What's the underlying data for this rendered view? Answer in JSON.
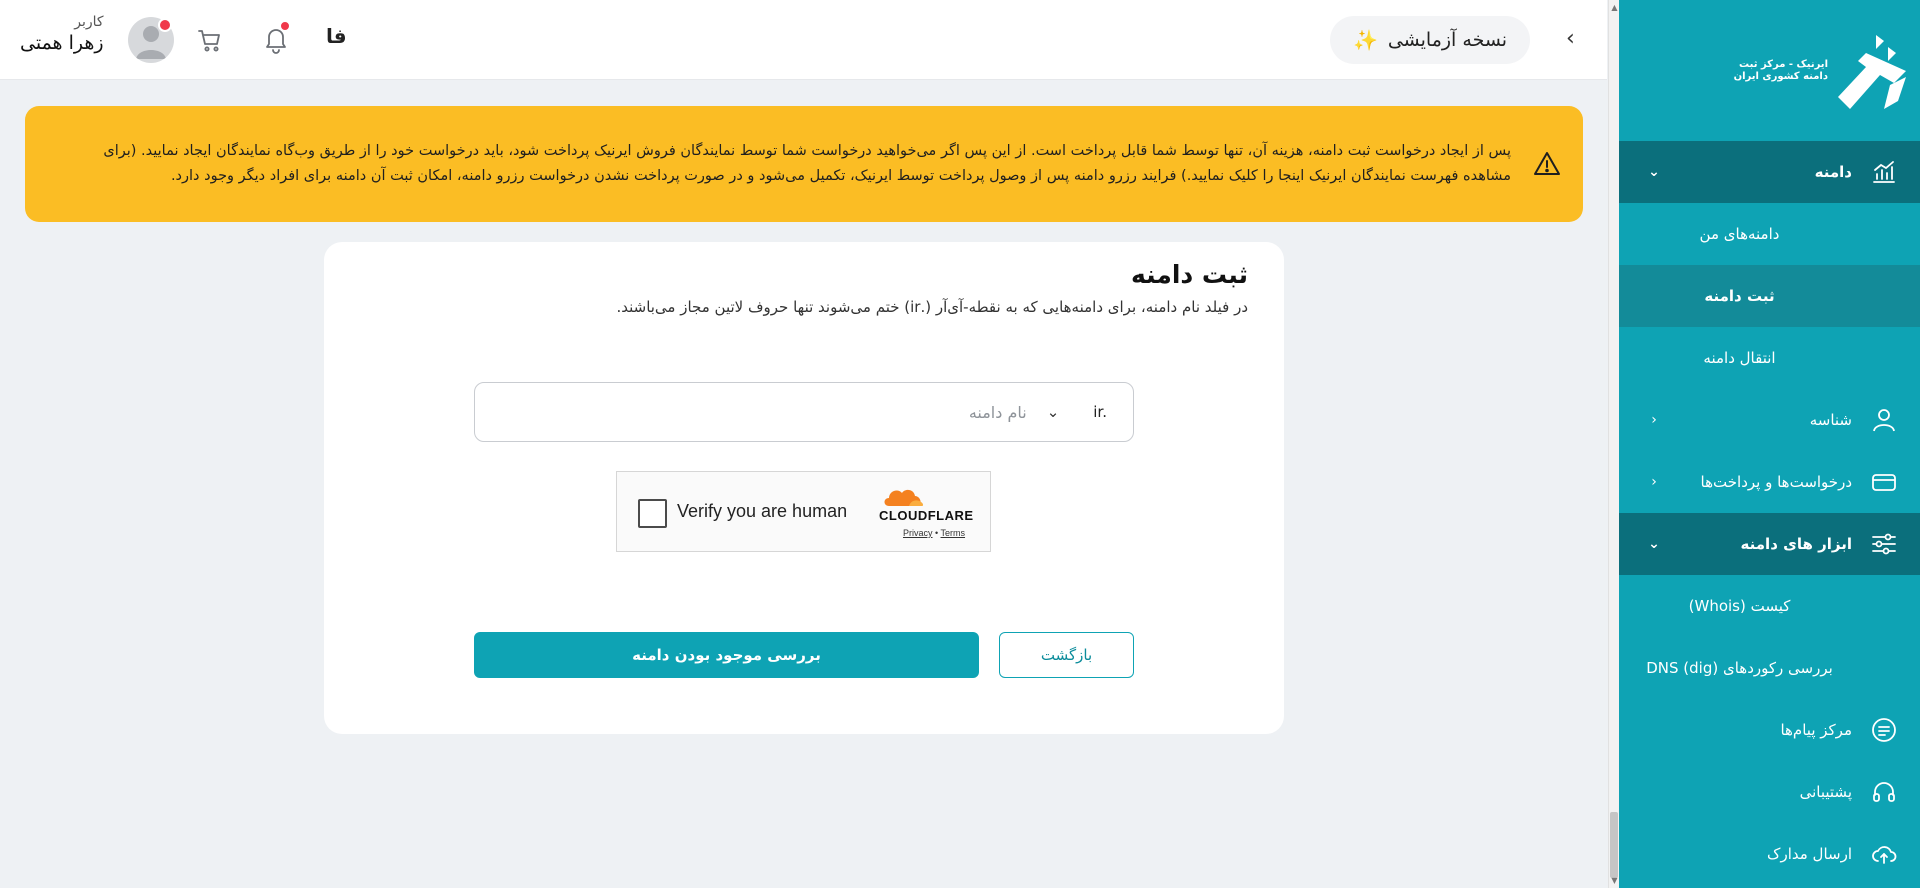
{
  "header": {
    "user_role": "کاربر",
    "user_name": "زهرا همتی",
    "language": "فا",
    "trial_label": "نسخه آزمایشی",
    "icons": {
      "avatar": "avatar-icon",
      "cart": "cart-icon",
      "notifications": "bell-icon",
      "trial": "sparkles-icon",
      "collapse": "chevron-left-icon"
    },
    "badge_color": "#f0384a"
  },
  "sidebar": {
    "logo_text": [
      "ایرنیک - مرکز ثبت",
      "دامنه کشوری ایران"
    ],
    "items": [
      {
        "label": "دامنه",
        "icon": "chart-icon",
        "open": true
      },
      {
        "label": "دامنه‌های من"
      },
      {
        "label": "ثبت دامنه",
        "active": true
      },
      {
        "label": "انتقال دامنه"
      },
      {
        "label": "شناسه",
        "icon": "user-icon"
      },
      {
        "label": "درخواست‌ها و پرداخت‌ها",
        "icon": "card-icon"
      },
      {
        "label": "ابزار های دامنه",
        "icon": "sliders-icon",
        "open": true
      },
      {
        "label": "کیست (Whois)"
      },
      {
        "label": "بررسی رکوردهای DNS (dig)"
      },
      {
        "label": "مرکز پیام‌ها",
        "icon": "message-icon"
      },
      {
        "label": "پشتیبانی",
        "icon": "headset-icon"
      },
      {
        "label": "ارسال مدارک",
        "icon": "upload-cloud-icon"
      }
    ],
    "colors": {
      "background": "#0ea3b4",
      "section": "#0b6f7c",
      "active": "#138b99"
    }
  },
  "warning": {
    "text": "پس از ایجاد درخواست ثبت دامنه، هزینه آن، تنها توسط شما قابل پرداخت است. از این پس اگر می‌خواهید درخواست شما توسط نمایندگان فروش ایرنیک پرداخت شود، باید درخواست خود را از طریق وب‌گاه نمایندگان ایجاد نمایید. (برای مشاهده فهرست نمایندگان ایرنیک اینجا را کلیک نمایید.) فرایند رزرو دامنه پس از وصول پرداخت توسط ایرنیک، تکمیل می‌شود و در صورت پرداخت نشدن درخواست رزرو دامنه، امکان ثبت آن دامنه برای افراد دیگر وجود دارد.",
    "icon": "warning-triangle-icon",
    "color": "#fbbd24"
  },
  "form": {
    "title": "ثبت دامنه",
    "description": "در فیلد نام دامنه، برای دامنه‌هایی که به نقطه-آی‌آر (.ir) ختم می‌شوند تنها حروف لاتین مجاز می‌باشند.",
    "domain_placeholder": "نام دامنه",
    "domain_value": "",
    "tld_value": "ir.",
    "captcha": {
      "label": "Verify you are human",
      "brand": "CLOUDFLARE",
      "privacy": "Privacy",
      "separator": "•",
      "terms": "Terms"
    },
    "back_label": "بازگشت",
    "check_label": "بررسی موجود بودن دامنه",
    "accent": "#0ea3b4"
  }
}
